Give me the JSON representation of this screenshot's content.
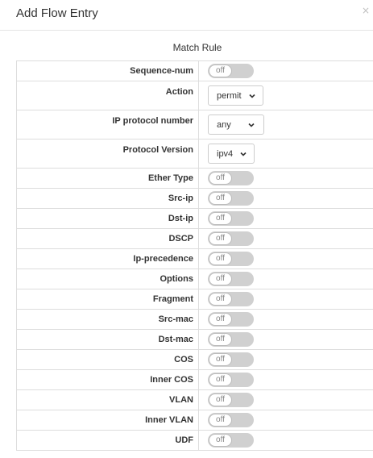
{
  "dialog": {
    "title": "Add Flow Entry",
    "close_glyph": "×"
  },
  "section_title": "Match Rule",
  "rows": {
    "sequence_num": {
      "label": "Sequence-num",
      "state": "off"
    },
    "action": {
      "label": "Action",
      "value": "permit"
    },
    "ip_protocol_number": {
      "label": "IP protocol number",
      "value": "any"
    },
    "protocol_version": {
      "label": "Protocol Version",
      "value": "ipv4"
    },
    "ether_type": {
      "label": "Ether Type",
      "state": "off"
    },
    "src_ip": {
      "label": "Src-ip",
      "state": "off"
    },
    "dst_ip": {
      "label": "Dst-ip",
      "state": "off"
    },
    "dscp": {
      "label": "DSCP",
      "state": "off"
    },
    "ip_precedence": {
      "label": "Ip-precedence",
      "state": "off"
    },
    "options": {
      "label": "Options",
      "state": "off"
    },
    "fragment": {
      "label": "Fragment",
      "state": "off"
    },
    "src_mac": {
      "label": "Src-mac",
      "state": "off"
    },
    "dst_mac": {
      "label": "Dst-mac",
      "state": "off"
    },
    "cos": {
      "label": "COS",
      "state": "off"
    },
    "inner_cos": {
      "label": "Inner COS",
      "state": "off"
    },
    "vlan": {
      "label": "VLAN",
      "state": "off"
    },
    "inner_vlan": {
      "label": "Inner VLAN",
      "state": "off"
    },
    "udf": {
      "label": "UDF",
      "state": "off"
    }
  },
  "colors": {
    "switch_off_track": "#d0d0d0",
    "border": "#dddddd",
    "label_text": "#333333"
  }
}
